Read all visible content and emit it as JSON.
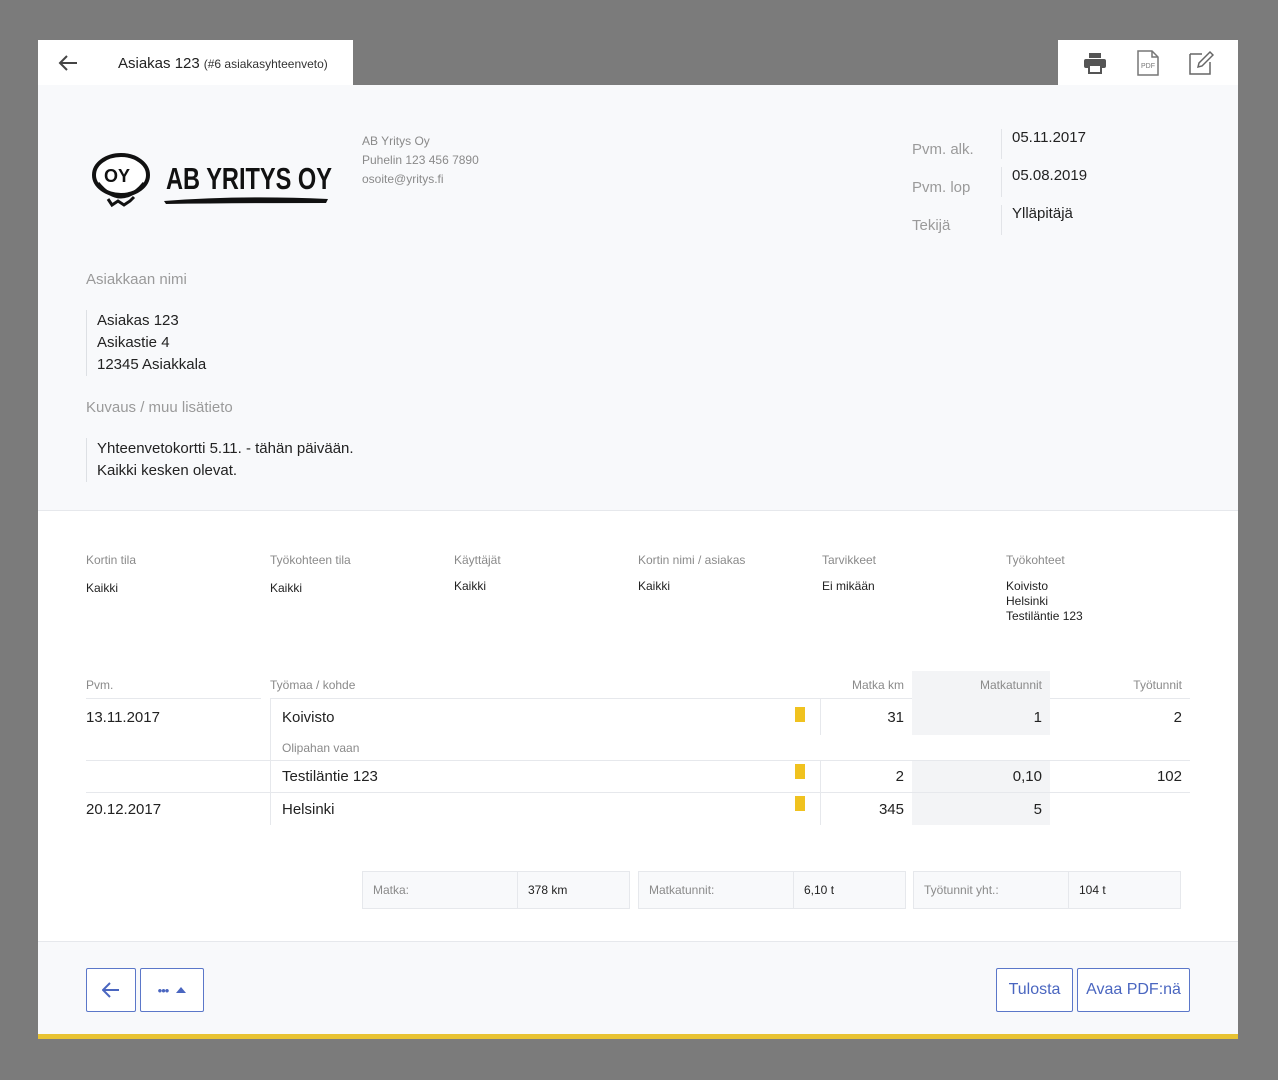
{
  "tab": {
    "title": "Asiakas 123",
    "subtitle": "(#6 asiakasyhteenveto)"
  },
  "toolbar": {
    "pdf_icon_text": "PDF"
  },
  "logo": {
    "badge_text": "OY",
    "company_text": "AB YRITYS OY"
  },
  "company": {
    "name": "AB Yritys Oy",
    "phone": "Puhelin 123 456 7890",
    "email": "osoite@yritys.fi"
  },
  "meta": {
    "start_label": "Pvm. alk.",
    "start_value": "05.11.2017",
    "end_label": "Pvm. lop",
    "end_value": "05.08.2019",
    "author_label": "Tekijä",
    "author_value": "Ylläpitäjä"
  },
  "customer": {
    "label": "Asiakkaan nimi",
    "name": "Asiakas 123",
    "street": "Asikastie 4",
    "city": "12345 Asiakkala"
  },
  "description": {
    "label": "Kuvaus / muu lisätieto",
    "line1": "Yhteenvetokortti 5.11. - tähän päivään.",
    "line2": "Kaikki kesken olevat."
  },
  "filters": [
    {
      "label": "Kortin tila",
      "value": "Kaikki"
    },
    {
      "label": "Työkohteen tila",
      "value": "Kaikki"
    },
    {
      "label": "Käyttäjät",
      "value": "Kaikki"
    },
    {
      "label": "Kortin nimi / asiakas",
      "value": "Kaikki"
    },
    {
      "label": "Tarvikkeet",
      "value": "Ei mikään"
    },
    {
      "label": "Työkohteet",
      "value": "Koivisto\nHelsinki\nTestiläntie 123"
    }
  ],
  "table": {
    "headers": {
      "date": "Pvm.",
      "site": "Työmaa / kohde",
      "km": "Matka km",
      "travel_hours": "Matkatunnit",
      "work_hours": "Työtunnit"
    },
    "rows": [
      {
        "date": "13.11.2017",
        "site": "Koivisto",
        "note": "Olipahan vaan",
        "km": "31",
        "travel_hours": "1",
        "work_hours": "2"
      },
      {
        "date": "",
        "site": "Testiläntie 123",
        "note": "",
        "km": "2",
        "travel_hours": "0,10",
        "work_hours": "102"
      },
      {
        "date": "20.12.2017",
        "site": "Helsinki",
        "note": "",
        "km": "345",
        "travel_hours": "5",
        "work_hours": ""
      }
    ],
    "status_color": "#f0c21f"
  },
  "totals": {
    "km_label": "Matka:",
    "km_value": "378 km",
    "travel_label": "Matkatunnit:",
    "travel_value": "6,10 t",
    "work_label": "Työtunnit yht.:",
    "work_value": "104 t"
  },
  "footer": {
    "more_label": "•••",
    "print_label": "Tulosta",
    "pdf_label": "Avaa PDF:nä"
  },
  "colors": {
    "accent": "#4a66c0",
    "highlight": "#e8c333"
  }
}
